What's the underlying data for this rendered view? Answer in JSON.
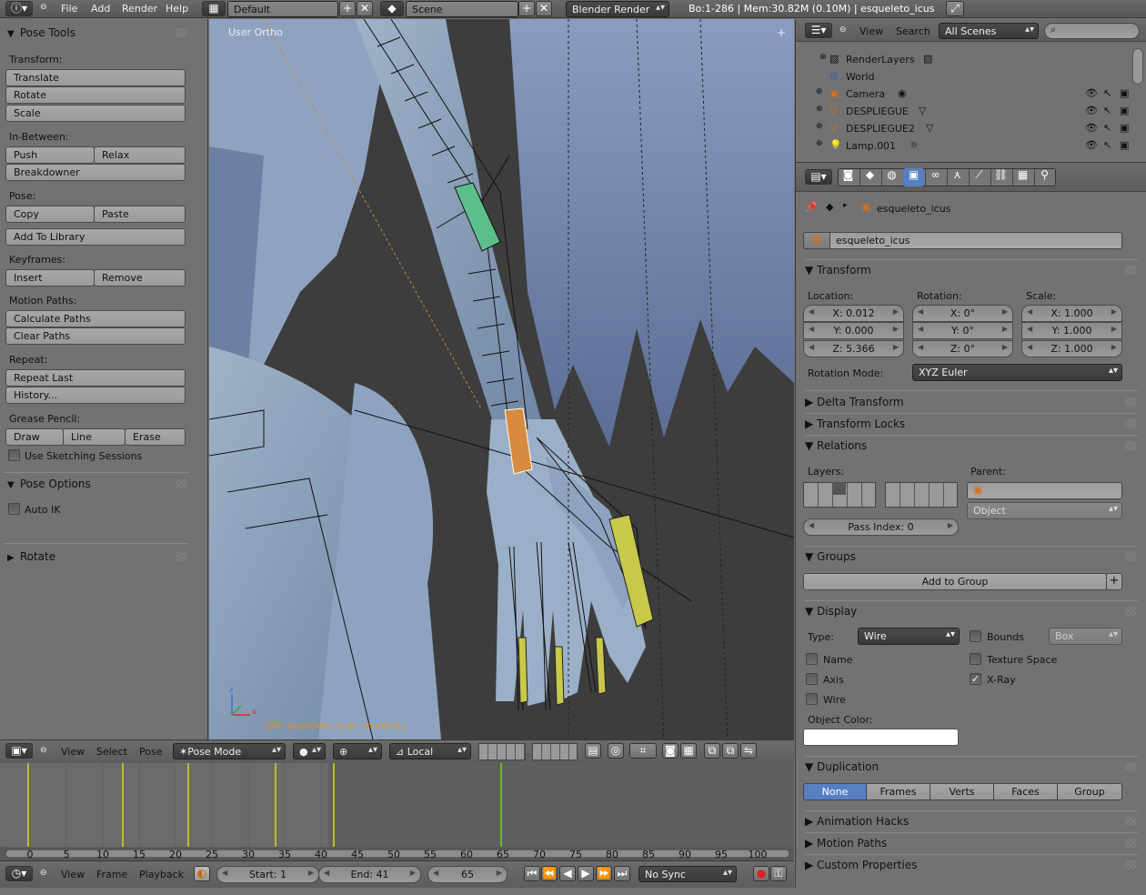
{
  "topbar": {
    "menus": [
      "File",
      "Add",
      "Render",
      "Help"
    ],
    "layout": "Default",
    "scene": "Scene",
    "engine": "Blender Render",
    "stats": "Bo:1-286  | Mem:30.82M (0.10M) | esqueleto_icus"
  },
  "tool_shelf": {
    "title": "Pose Tools",
    "transform_label": "Transform:",
    "translate": "Translate",
    "rotate": "Rotate",
    "scale": "Scale",
    "inbetween_label": "In-Between:",
    "push": "Push",
    "relax": "Relax",
    "breakdowner": "Breakdowner",
    "pose_label": "Pose:",
    "copy": "Copy",
    "paste": "Paste",
    "add_library": "Add To Library",
    "keyframes_label": "Keyframes:",
    "insert": "Insert",
    "remove": "Remove",
    "motion_label": "Motion Paths:",
    "calc_paths": "Calculate Paths",
    "clear_paths": "Clear Paths",
    "repeat_label": "Repeat:",
    "repeat_last": "Repeat Last",
    "history": "History...",
    "grease_label": "Grease Pencil:",
    "draw": "Draw",
    "line": "Line",
    "erase": "Erase",
    "sketch": "Use Sketching Sessions",
    "pose_options": "Pose Options",
    "auto_ik": "Auto IK",
    "rotate_panel": "Rotate"
  },
  "viewport": {
    "view_label": "User Ortho",
    "object_label": "(65) esqueleto_icus : muneca.L"
  },
  "view3d_header": {
    "menus": [
      "View",
      "Select",
      "Pose"
    ],
    "mode": "Pose Mode",
    "orientation": "Local"
  },
  "timeline": {
    "ticks": [
      "0",
      "5",
      "10",
      "15",
      "20",
      "25",
      "30",
      "35",
      "40",
      "45",
      "50",
      "55",
      "60",
      "65",
      "70",
      "75",
      "80",
      "85",
      "90",
      "95",
      "100"
    ],
    "keyframes": [
      0,
      13,
      22,
      34,
      42,
      65
    ],
    "current_frame": 65,
    "menus": [
      "View",
      "Frame",
      "Playback"
    ],
    "start": "Start: 1",
    "end": "End: 41",
    "frame": "65",
    "sync": "No Sync"
  },
  "outliner": {
    "menus": [
      "View",
      "Search"
    ],
    "filter": "All Scenes",
    "rows": [
      "RenderLayers",
      "World",
      "Camera",
      "DESPLIEGUE",
      "DESPLIEGUE2",
      "Lamp.001"
    ]
  },
  "properties": {
    "breadcrumb": "esqueleto_icus",
    "object_name": "esqueleto_icus",
    "transform": "Transform",
    "location_label": "Location:",
    "rotation_label": "Rotation:",
    "scale_label": "Scale:",
    "loc": [
      "X: 0.012",
      "Y: 0.000",
      "Z: 5.366"
    ],
    "rot": [
      "X: 0°",
      "Y: 0°",
      "Z: 0°"
    ],
    "scl": [
      "X: 1.000",
      "Y: 1.000",
      "Z: 1.000"
    ],
    "rotation_mode_label": "Rotation Mode:",
    "rotation_mode": "XYZ Euler",
    "delta": "Delta Transform",
    "locks": "Transform Locks",
    "relations": "Relations",
    "layers_label": "Layers:",
    "parent_label": "Parent:",
    "parent_type": "Object",
    "pass_index": "Pass Index: 0",
    "groups": "Groups",
    "add_group": "Add to Group",
    "display": "Display",
    "type_label": "Type:",
    "type_value": "Wire",
    "bounds": "Bounds",
    "box": "Box",
    "name": "Name",
    "texture_space": "Texture Space",
    "axis": "Axis",
    "xray": "X-Ray",
    "wire": "Wire",
    "object_color": "Object Color:",
    "duplication": "Duplication",
    "dup_options": [
      "None",
      "Frames",
      "Verts",
      "Faces",
      "Group"
    ],
    "anim_hacks": "Animation Hacks",
    "motion_paths": "Motion Paths",
    "custom_props": "Custom Properties"
  },
  "colors": {
    "accent": "#5680c2",
    "keyframe": "#d8d81a",
    "current_frame": "#60c020"
  }
}
